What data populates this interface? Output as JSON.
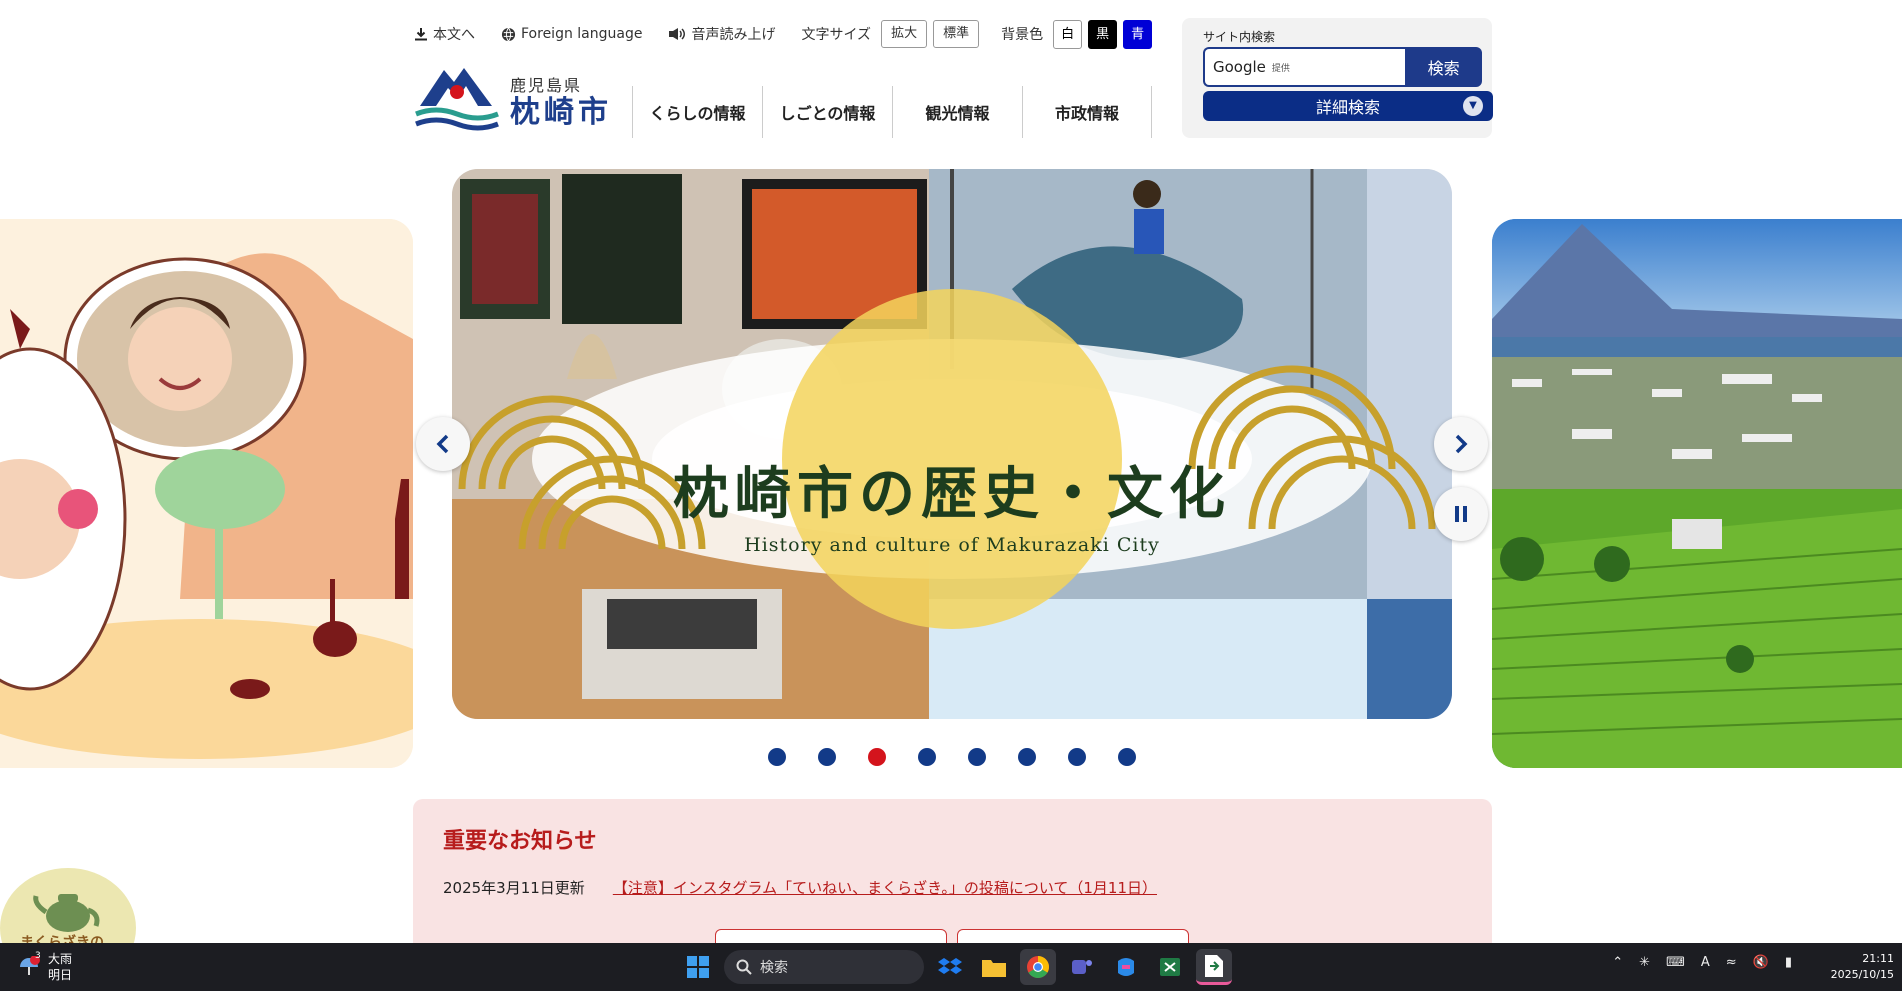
{
  "utility": {
    "skip_link": "本文へ",
    "foreign": "Foreign language",
    "read_aloud": "音声読み上げ",
    "font_size_label": "文字サイズ",
    "font_larger": "拡大",
    "font_standard": "標準",
    "bg_label": "背景色",
    "bg_white": "白",
    "bg_black": "黒",
    "bg_blue": "青"
  },
  "logo": {
    "prefecture": "鹿児島県",
    "city": "枕崎市"
  },
  "nav": [
    "くらしの情報",
    "しごとの情報",
    "観光情報",
    "市政情報"
  ],
  "search": {
    "title": "サイト内検索",
    "input_brand": "Google",
    "input_brand_sub": "提供",
    "button": "検索",
    "advanced": "詳細検索"
  },
  "carousel": {
    "title_jp": "枕崎市の歴史・文化",
    "title_en": "History and culture of Makurazaki City",
    "slide_count": 8,
    "active_index": 3
  },
  "notice": {
    "heading": "重要なお知らせ",
    "date": "2025年3月11日更新",
    "link": "【注意】インスタグラム「ていねい、まくらざき。」の投稿について（1月11日）"
  },
  "mascot_text": "まくらざきの",
  "taskbar": {
    "weather_badge": "3",
    "weather_main": "大雨",
    "weather_sub": "明日",
    "search_placeholder": "検索",
    "clock_time": "21:11",
    "clock_date": "2025/10/15"
  },
  "colors": {
    "brand_blue": "#1e3a8a",
    "active_dot": "#d4141c",
    "notice_red": "#b71c1c"
  }
}
